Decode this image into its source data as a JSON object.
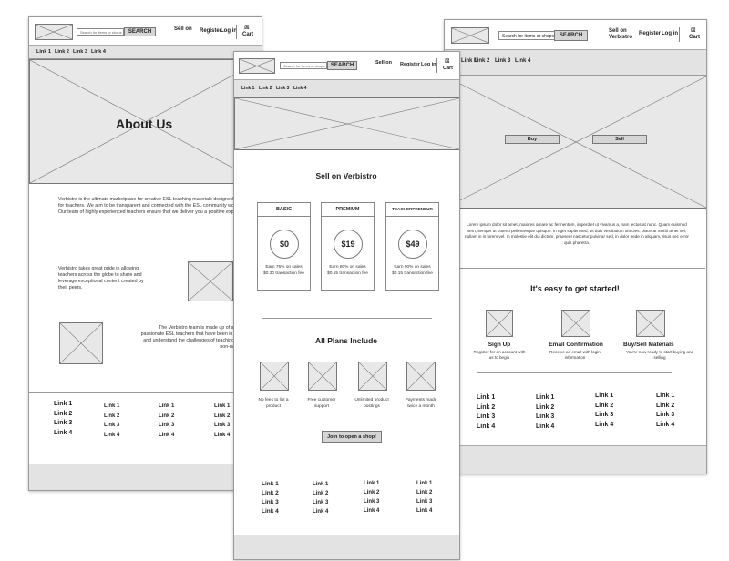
{
  "header": {
    "search_placeholder_small": "Search for items or shops",
    "search_placeholder_right": "Search for items or shops",
    "search_button": "SEARCH",
    "sell_on": "Sell on",
    "sell_on_verbistro": "Sell on Verbistro",
    "register": "Register",
    "login": "Log in",
    "cart": "Cart"
  },
  "nav": [
    "Link 1",
    "Link 2",
    "Link 3",
    "Link 4"
  ],
  "about_page": {
    "hero_title": "About Us",
    "intro": "Verbistro is the ultimate marketplace for creative ESL teaching materials designed by teacher for teachers. We aim to be transparent and connected with the ESL community world-wide. Our team of highly experienced teachers ensure that we deliver you a positive experience.",
    "pride": "Verbistro takes great pride in allowing teachers across the globe to share and leverage exceptional content created by their peers.",
    "team": "The Verbistro team is made up of a collection of passionate ESL teachers that have been in the trenches and understand the challenges of teaching English in a non-native country."
  },
  "sell_page": {
    "title": "Sell on Verbistro",
    "plans": [
      {
        "name": "BASIC",
        "price": "$0",
        "desc": "Earn 75% on sales $0.30 transaction fee"
      },
      {
        "name": "PREMIUM",
        "price": "$19",
        "desc": "Earn 80% on sales $0.15 transaction fee"
      },
      {
        "name": "TEACHERPRENEUR",
        "price": "$49",
        "desc": "Earn 90% on sales $0.15 transaction fee"
      }
    ],
    "includes_title": "All Plans Include",
    "includes": [
      "No fees to list a product",
      "Free customer support",
      "Unlimited product postings",
      "Payments made twice a month"
    ],
    "join_button": "Join to open a shop!"
  },
  "home_page": {
    "buy_button": "Buy",
    "sell_button": "Sell",
    "lorem": "Lorem ipsum dolor sit amet, maiores ornare ac fermentum, imperdiet ut vivamus a, nam lectus at nunc. Quam euismod sem, semper ut potenti pellentesque quisque. In eget sapien sed, sit duis vestibulum ultricies, placerat morbi amet vel, nullam in in lorem vel. In molestie elit dui dictum, praesent nascetur pulvinar sed, in dolor pede in aliquam, risus nec error quis pharetra.",
    "started_title": "It's easy to get started!",
    "steps": [
      {
        "title": "Sign Up",
        "desc": "Register for an account with us to begin"
      },
      {
        "title": "Email Confirmation",
        "desc": "Receive an email with login information"
      },
      {
        "title": "Buy/Sell Materials",
        "desc": "You're now ready to start buying and selling"
      }
    ]
  },
  "footer_links": [
    "Link 1",
    "Link 2",
    "Link 3",
    "Link 4"
  ]
}
